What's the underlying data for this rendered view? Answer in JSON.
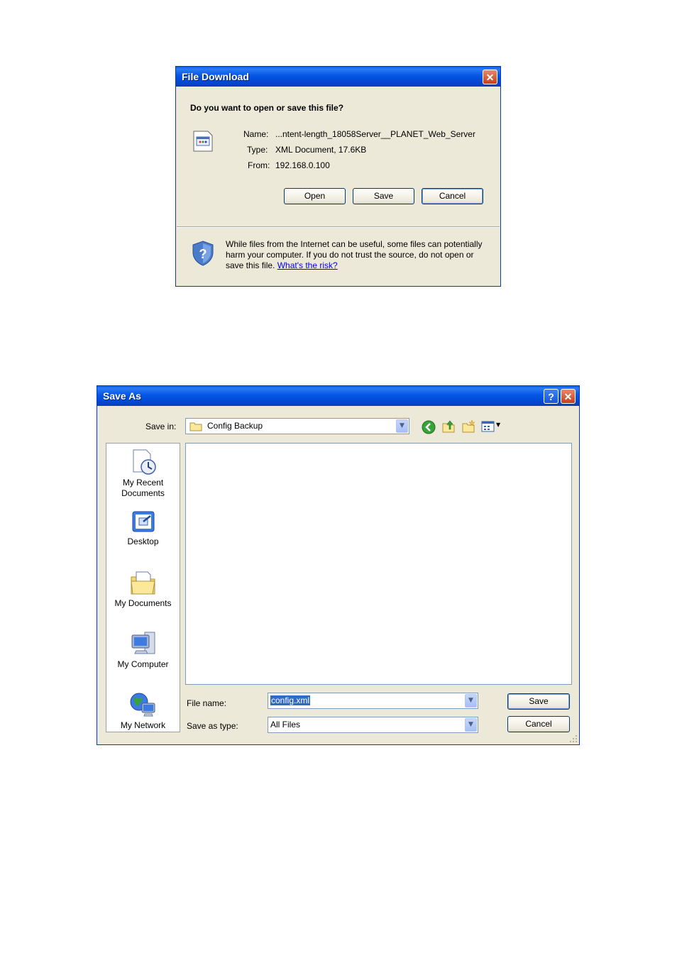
{
  "file_download": {
    "title": "File Download",
    "question": "Do you want to open or save this file?",
    "name_label": "Name:",
    "name_value": "...ntent-length_18058Server__PLANET_Web_Server",
    "type_label": "Type:",
    "type_value": "XML Document, 17.6KB",
    "from_label": "From:",
    "from_value": "192.168.0.100",
    "open_button": "Open",
    "save_button": "Save",
    "cancel_button": "Cancel",
    "warning_text": "While files from the Internet can be useful, some files can potentially harm your computer. If you do not trust the source, do not open or save this file.",
    "risk_link": "What's the risk?"
  },
  "save_as": {
    "title": "Save As",
    "save_in_label": "Save in:",
    "save_in_value": "Config Backup",
    "places": [
      {
        "label": "My Recent Documents",
        "icon": "recent-documents-icon"
      },
      {
        "label": "Desktop",
        "icon": "desktop-icon"
      },
      {
        "label": "My Documents",
        "icon": "my-documents-icon"
      },
      {
        "label": "My Computer",
        "icon": "my-computer-icon"
      },
      {
        "label": "My Network",
        "icon": "my-network-icon"
      }
    ],
    "file_name_label": "File name:",
    "file_name_value": "config.xml",
    "save_type_label": "Save as type:",
    "save_type_value": "All Files",
    "save_button": "Save",
    "cancel_button": "Cancel"
  }
}
